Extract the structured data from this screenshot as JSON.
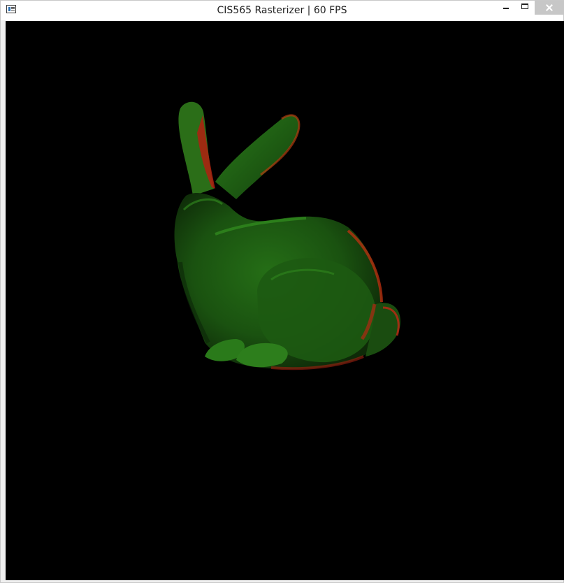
{
  "window": {
    "title": "CIS565 Rasterizer | 60 FPS",
    "icons": {
      "app": "app-window-icon",
      "minimize": "minimize-icon",
      "maximize": "maximize-icon",
      "close": "close-icon"
    }
  },
  "viewport": {
    "background": "#000000",
    "content": "stanford-bunny-render",
    "shading_colors": {
      "main": "#1c5a12",
      "highlight": "#2e8a1e",
      "rim": "#b0200f",
      "shadow": "#0f2e0a"
    }
  }
}
